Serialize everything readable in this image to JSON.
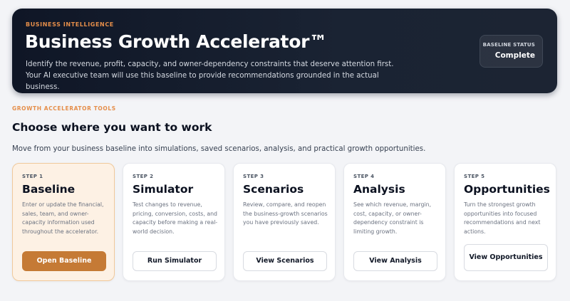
{
  "hero": {
    "eyebrow": "BUSINESS INTELLIGENCE",
    "title": "Business Growth Accelerator™",
    "description": "Identify the revenue, profit, capacity, and owner-dependency constraints that deserve attention first. Your AI executive team will use this baseline to provide recommendations grounded in the actual business.",
    "status_label": "BASELINE STATUS",
    "status_value": "Complete"
  },
  "tools": {
    "eyebrow": "GROWTH ACCELERATOR TOOLS",
    "title": "Choose where you want to work",
    "description": "Move from your business baseline into simulations, saved scenarios, analysis, and practical growth opportunities."
  },
  "cards": [
    {
      "step": "STEP 1",
      "title": "Baseline",
      "description": "Enter or update the financial, sales, team, and owner-capacity information used throughout the accelerator.",
      "button": "Open Baseline"
    },
    {
      "step": "STEP 2",
      "title": "Simulator",
      "description": "Test changes to revenue, pricing, conversion, costs, and capacity before making a real-world decision.",
      "button": "Run Simulator"
    },
    {
      "step": "STEP 3",
      "title": "Scenarios",
      "description": "Review, compare, and reopen the business-growth scenarios you have previously saved.",
      "button": "View Scenarios"
    },
    {
      "step": "STEP 4",
      "title": "Analysis",
      "description": "See which revenue, margin, cost, capacity, or owner-dependency constraint is limiting growth.",
      "button": "View Analysis"
    },
    {
      "step": "STEP 5",
      "title": "Opportunities",
      "description": "Turn the strongest growth opportunities into focused recommendations and next actions.",
      "button": "View Opportunities"
    }
  ],
  "colors": {
    "accent": "#c57a35",
    "eyebrow": "#e58e4a",
    "hero_bg": "#161e2d",
    "active_card_bg": "#fdf1e4"
  }
}
